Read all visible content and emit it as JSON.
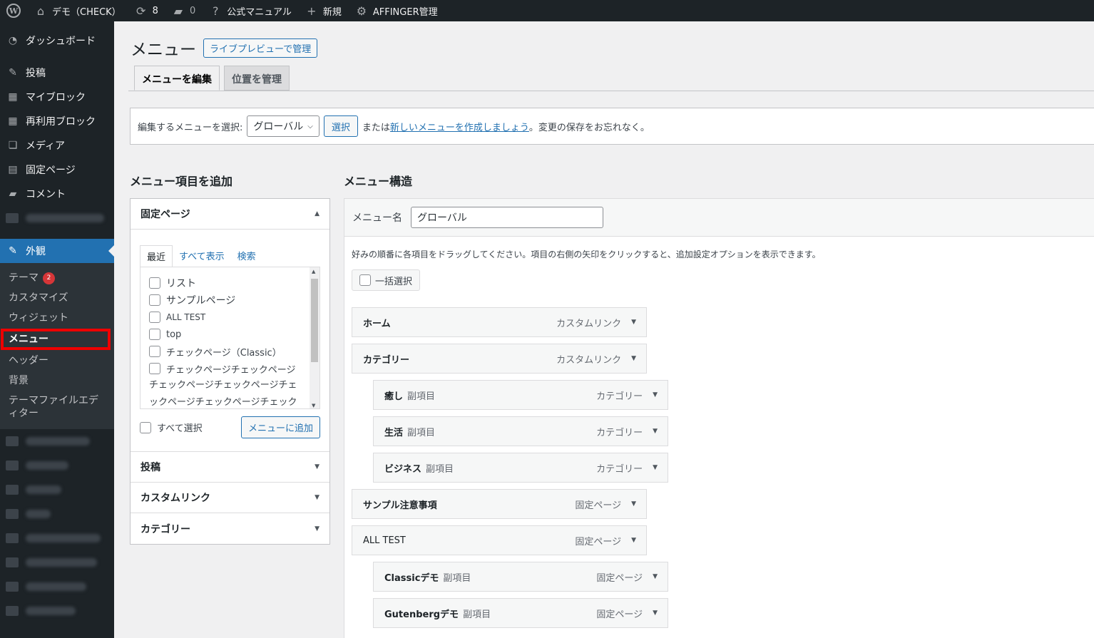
{
  "adminbar": {
    "site_name": "デモ（CHECK）",
    "updates_count": "8",
    "comments_count": "0",
    "manual": "公式マニュアル",
    "new": "新規",
    "affinger": "AFFINGER管理"
  },
  "sidebar": {
    "items": [
      {
        "label": "ダッシュボード",
        "icon": "gauge-icon"
      },
      {
        "label": "投稿",
        "icon": "pin-icon"
      },
      {
        "label": "マイブロック",
        "icon": "grid-icon"
      },
      {
        "label": "再利用ブロック",
        "icon": "grid-icon"
      },
      {
        "label": "メディア",
        "icon": "media-icon"
      },
      {
        "label": "固定ページ",
        "icon": "page-icon"
      },
      {
        "label": "コメント",
        "icon": "comment-icon"
      }
    ],
    "current": "外観",
    "submenu": [
      {
        "label": "テーマ",
        "badge": "2"
      },
      {
        "label": "カスタマイズ"
      },
      {
        "label": "ウィジェット"
      },
      {
        "label": "メニュー"
      },
      {
        "label": "ヘッダー"
      },
      {
        "label": "背景"
      },
      {
        "label": "テーマファイルエディター"
      }
    ]
  },
  "page": {
    "title": "メニュー",
    "live_preview": "ライブプレビューで管理",
    "tabs": [
      "メニューを編集",
      "位置を管理"
    ],
    "select_label": "編集するメニューを選択:",
    "select_value": "グローバル",
    "select_button": "選択",
    "or_text": "または",
    "create_link": "新しいメニューを作成しましょう",
    "save_note": "。変更の保存をお忘れなく。"
  },
  "add_items": {
    "title": "メニュー項目を追加",
    "panel_title": "固定ページ",
    "subtabs": [
      "最近",
      "すべて表示",
      "検索"
    ],
    "pages": [
      "リスト",
      "サンプルページ",
      "ALL TEST",
      "top",
      "チェックページ（Classic）",
      "チェックページチェックページ"
    ],
    "long_text": "チェックページチェックページチェックページチェックページチェック",
    "select_all": "すべて選択",
    "add_button": "メニューに追加",
    "other_panels": [
      "投稿",
      "カスタムリンク",
      "カテゴリー"
    ]
  },
  "structure": {
    "title": "メニュー構造",
    "name_label": "メニュー名",
    "name_value": "グローバル",
    "instructions": "好みの順番に各項目をドラッグしてください。項目の右側の矢印をクリックすると、追加設定オプションを表示できます。",
    "bulk_select": "一括選択",
    "sub_label": "副項目",
    "items": [
      {
        "title": "ホーム",
        "type": "カスタムリンク",
        "sub": false
      },
      {
        "title": "カテゴリー",
        "type": "カスタムリンク",
        "sub": false
      },
      {
        "title": "癒し",
        "type": "カテゴリー",
        "sub": true
      },
      {
        "title": "生活",
        "type": "カテゴリー",
        "sub": true
      },
      {
        "title": "ビジネス",
        "type": "カテゴリー",
        "sub": true
      },
      {
        "title": "サンプル注意事項",
        "type": "固定ページ",
        "sub": false
      },
      {
        "title": "ALL TEST",
        "type": "固定ページ",
        "sub": false
      },
      {
        "title": "Classicデモ",
        "type": "固定ページ",
        "sub": true
      },
      {
        "title": "Gutenbergデモ",
        "type": "固定ページ",
        "sub": true
      }
    ]
  },
  "colors": {
    "accent": "#2271b1",
    "adminbar": "#1d2327",
    "badge": "#d63638"
  }
}
